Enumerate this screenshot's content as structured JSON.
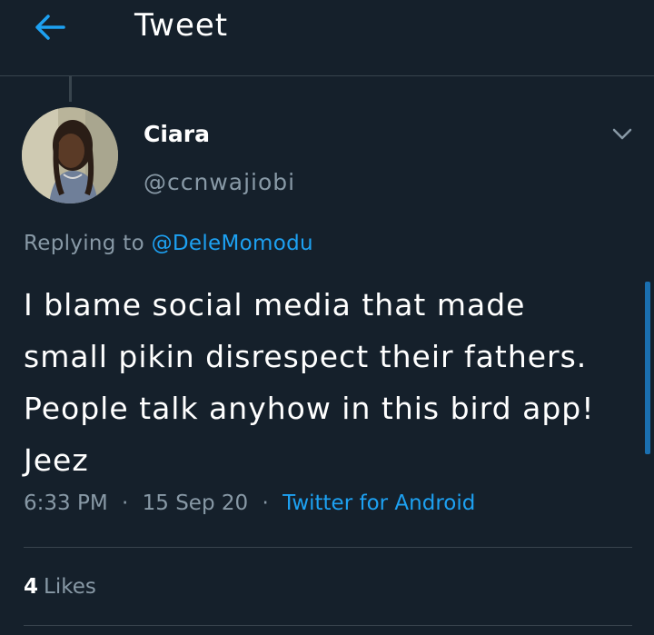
{
  "header": {
    "title": "Tweet",
    "back_icon": "arrow-left-icon"
  },
  "tweet": {
    "author": {
      "name": "Ciara",
      "handle": "@ccnwajiobi"
    },
    "replying_prefix": "Replying to",
    "replying_to": "@DeleMomodu",
    "text_lines": [
      "I blame social media that made",
      "small pikin disrespect their fathers.",
      "People talk anyhow in this bird app!",
      "Jeez"
    ],
    "time": "6:33 PM",
    "date": "15 Sep 20",
    "separator": "·",
    "source": "Twitter for Android",
    "likes_count": "4",
    "likes_label": "Likes"
  },
  "colors": {
    "background": "#15202b",
    "accent": "#1da1f2",
    "muted": "#8899a6",
    "divider": "#38444d"
  }
}
